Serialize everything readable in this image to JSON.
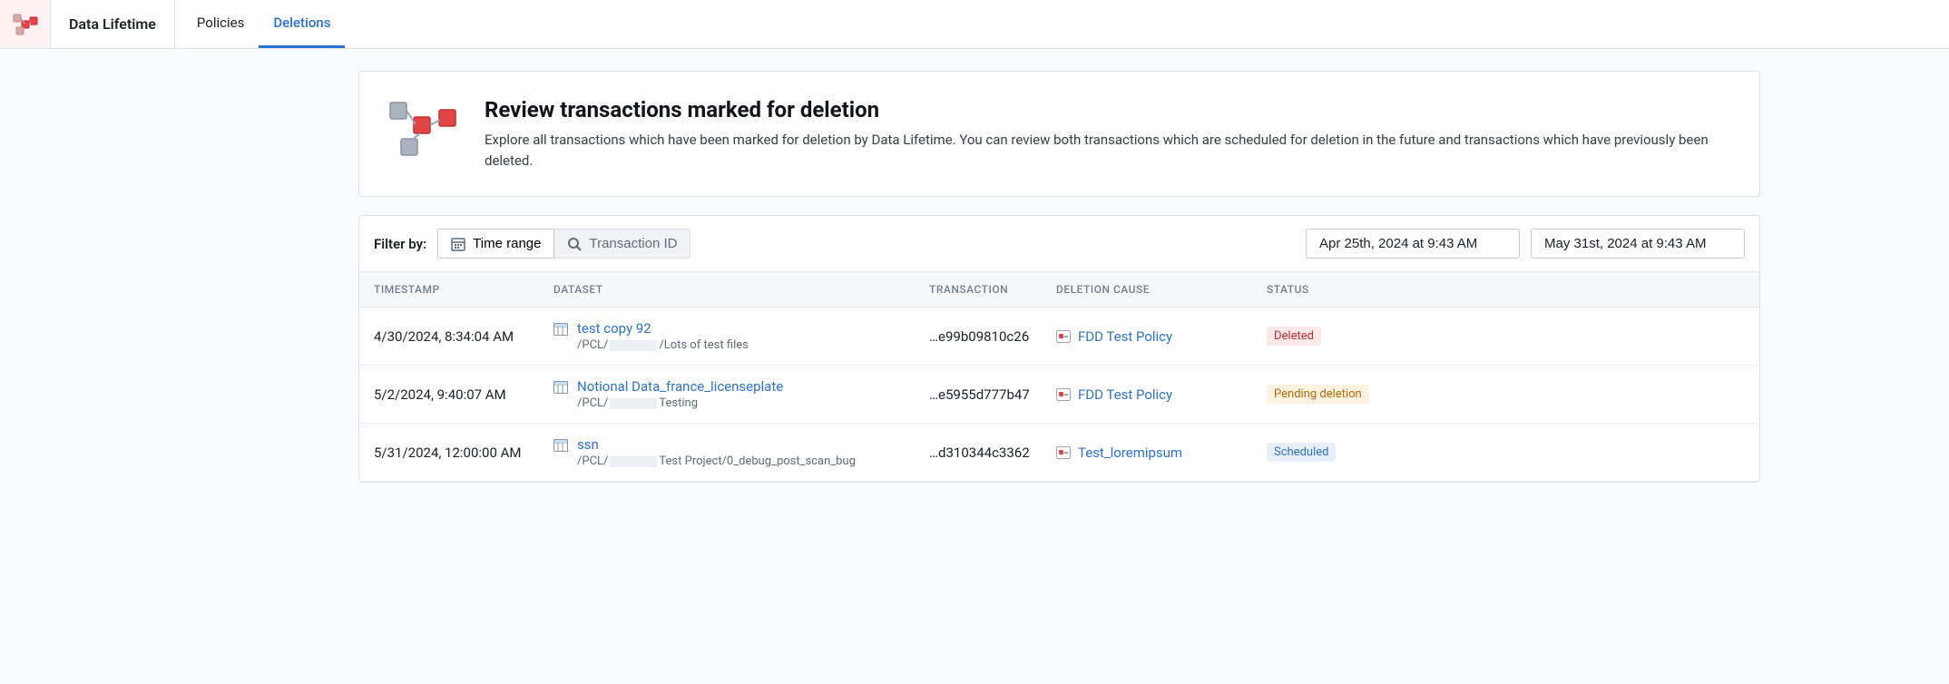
{
  "app": {
    "title": "Data Lifetime"
  },
  "nav": {
    "tabs": [
      {
        "label": "Policies",
        "active": false
      },
      {
        "label": "Deletions",
        "active": true
      }
    ]
  },
  "header": {
    "title": "Review transactions marked for deletion",
    "description": "Explore all transactions which have been marked for deletion by Data Lifetime. You can review both transactions which are scheduled for deletion in the future and transactions which have previously been deleted."
  },
  "filter": {
    "label": "Filter by:",
    "options": [
      {
        "label": "Time range",
        "active": true,
        "icon": "calendar"
      },
      {
        "label": "Transaction ID",
        "active": false,
        "icon": "search"
      }
    ],
    "date_from": "Apr 25th, 2024 at 9:43 AM",
    "date_to": "May 31st, 2024 at 9:43 AM"
  },
  "table": {
    "columns": [
      "TIMESTAMP",
      "DATASET",
      "TRANSACTION",
      "DELETION CAUSE",
      "STATUS"
    ],
    "rows": [
      {
        "timestamp": "4/30/2024, 8:34:04 AM",
        "dataset_name": "test copy 92",
        "dataset_path_prefix": "/PCL/",
        "dataset_path_suffix": "/Lots of test files",
        "transaction": "…e99b09810c26",
        "cause": "FDD Test Policy",
        "status": "Deleted",
        "status_class": "deleted"
      },
      {
        "timestamp": "5/2/2024, 9:40:07 AM",
        "dataset_name": "Notional Data_france_licenseplate",
        "dataset_path_prefix": "/PCL/",
        "dataset_path_suffix": "Testing",
        "transaction": "…e5955d777b47",
        "cause": "FDD Test Policy",
        "status": "Pending deletion",
        "status_class": "pending"
      },
      {
        "timestamp": "5/31/2024, 12:00:00 AM",
        "dataset_name": "ssn",
        "dataset_path_prefix": "/PCL/",
        "dataset_path_suffix": "Test Project/0_debug_post_scan_bug",
        "transaction": "…d310344c3362",
        "cause": "Test_loremipsum",
        "status": "Scheduled",
        "status_class": "scheduled"
      }
    ]
  }
}
